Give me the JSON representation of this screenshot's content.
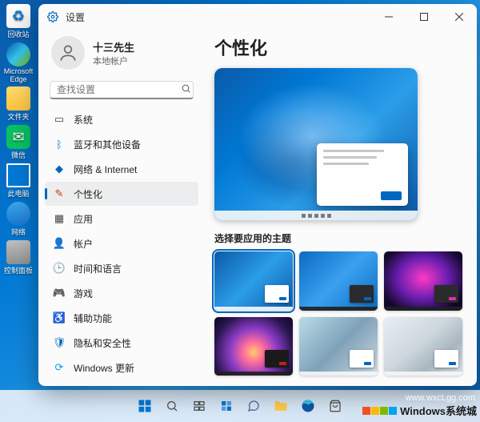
{
  "desktop_icons": [
    {
      "key": "recycle",
      "label": "回收站",
      "glyph": "♻"
    },
    {
      "key": "edge",
      "label": "Microsoft Edge",
      "glyph": ""
    },
    {
      "key": "folder",
      "label": "文件夹",
      "glyph": ""
    },
    {
      "key": "wechat",
      "label": "微信",
      "glyph": "✉"
    },
    {
      "key": "pc",
      "label": "此电脑",
      "glyph": ""
    },
    {
      "key": "net",
      "label": "网络",
      "glyph": ""
    },
    {
      "key": "ctrl",
      "label": "控制面板",
      "glyph": ""
    }
  ],
  "settings": {
    "app_title": "设置",
    "account_name": "十三先生",
    "account_type": "本地帐户",
    "search_placeholder": "查找设置",
    "nav": [
      {
        "key": "system",
        "label": "系统",
        "icon": "▭",
        "cls": "c-sys"
      },
      {
        "key": "bluetooth",
        "label": "蓝牙和其他设备",
        "icon": "ᛒ",
        "cls": "c-bt"
      },
      {
        "key": "network",
        "label": "网络 & Internet",
        "icon": "◆",
        "cls": "c-net"
      },
      {
        "key": "personalization",
        "label": "个性化",
        "icon": "✎",
        "cls": "c-pers",
        "active": true
      },
      {
        "key": "apps",
        "label": "应用",
        "icon": "▦",
        "cls": "c-apps"
      },
      {
        "key": "accounts",
        "label": "帐户",
        "icon": "👤",
        "cls": "c-acct"
      },
      {
        "key": "time",
        "label": "时间和语言",
        "icon": "🕒",
        "cls": "c-time"
      },
      {
        "key": "gaming",
        "label": "游戏",
        "icon": "🎮",
        "cls": "c-game"
      },
      {
        "key": "accessibility",
        "label": "辅助功能",
        "icon": "♿",
        "cls": "c-acc"
      },
      {
        "key": "privacy",
        "label": "隐私和安全性",
        "icon": "🛡",
        "cls": "c-priv"
      },
      {
        "key": "update",
        "label": "Windows 更新",
        "icon": "⟳",
        "cls": "c-upd"
      }
    ],
    "page_title": "个性化",
    "themes_label": "选择要应用的主题",
    "themes": [
      {
        "key": "t1",
        "selected": true
      },
      {
        "key": "t2",
        "selected": false
      },
      {
        "key": "t3",
        "selected": false
      },
      {
        "key": "t4",
        "selected": false
      },
      {
        "key": "t5",
        "selected": false
      },
      {
        "key": "t6",
        "selected": false
      }
    ]
  },
  "watermark": {
    "text": "Windows系统城",
    "url": "www.wxcLgg.com"
  }
}
